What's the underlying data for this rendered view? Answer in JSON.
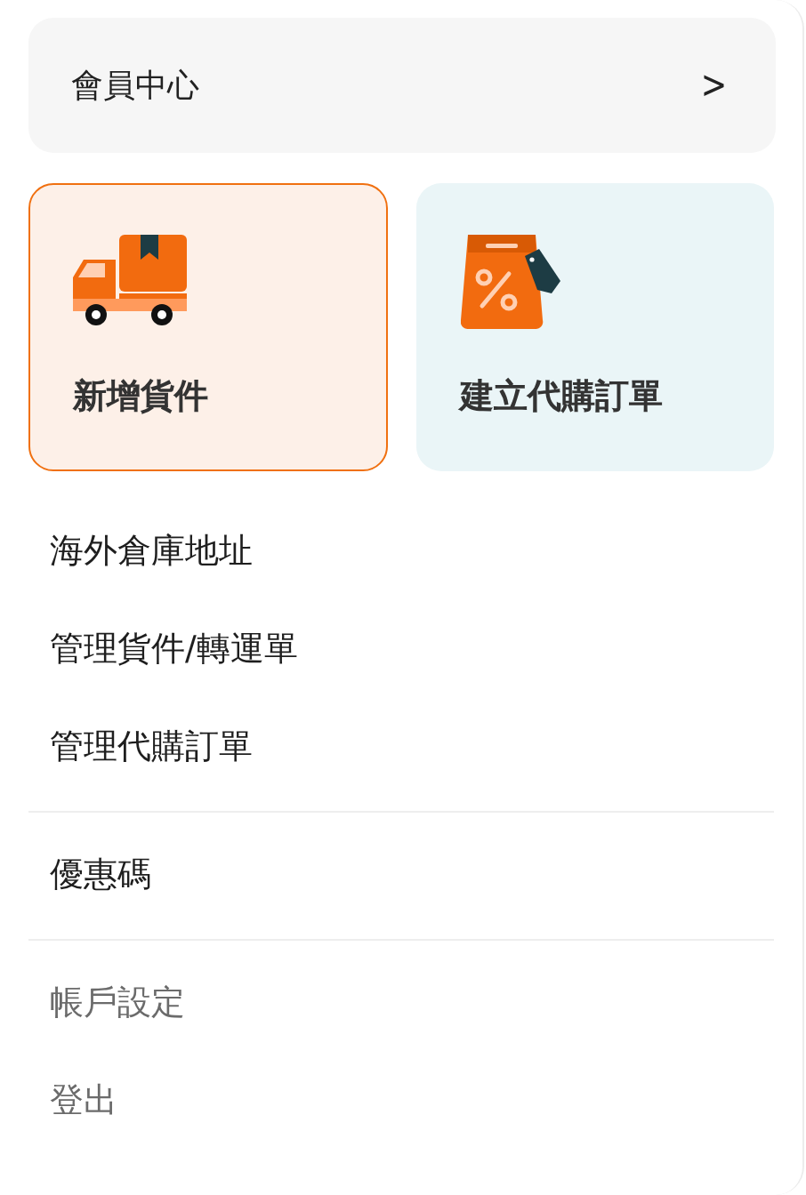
{
  "member_center": {
    "label": "會員中心",
    "chevron": ">"
  },
  "tiles": [
    {
      "label": "新增貨件",
      "kind": "truck",
      "selected": true
    },
    {
      "label": "建立代購訂單",
      "kind": "bag",
      "selected": false
    }
  ],
  "menu_groups": [
    {
      "kind": "primary",
      "items": [
        "海外倉庫地址",
        "管理貨件/轉運單",
        "管理代購訂單"
      ]
    },
    {
      "kind": "primary",
      "items": [
        "優惠碼"
      ]
    },
    {
      "kind": "secondary",
      "items": [
        "帳戶設定",
        "登出"
      ]
    }
  ]
}
